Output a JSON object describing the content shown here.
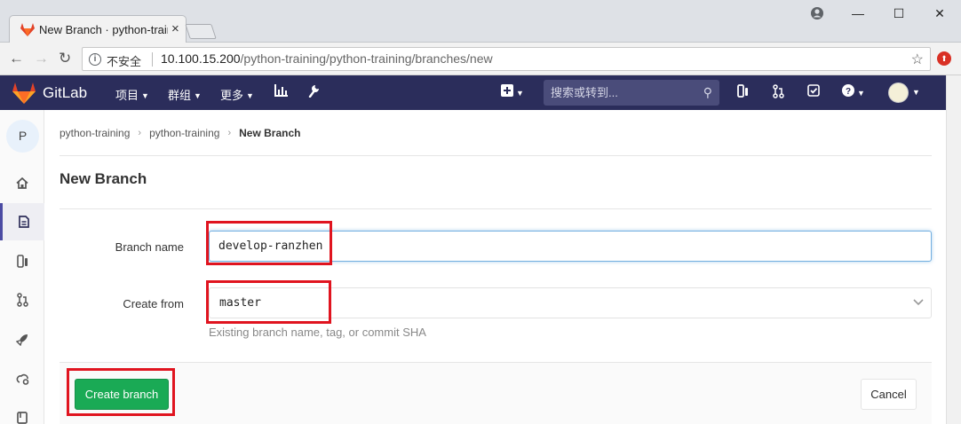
{
  "browser": {
    "tab_title": "New Branch · python-training · GitLab",
    "insecure_label": "不安全",
    "url_host": "10.100.15.200",
    "url_path": "/python-training/python-training/branches/new",
    "window_controls": [
      "profile-icon",
      "minimize-icon",
      "maximize-icon",
      "close-icon"
    ]
  },
  "navbar": {
    "brand": "GitLab",
    "menus": [
      {
        "label": "项目"
      },
      {
        "label": "群组"
      },
      {
        "label": "更多"
      }
    ],
    "search_placeholder": "搜索或转到...",
    "icons": [
      "activity-chart-icon",
      "admin-wrench-icon",
      "new-plus-icon",
      "issues-icon",
      "merge-requests-icon",
      "todos-icon",
      "help-icon",
      "user-avatar"
    ]
  },
  "sidebar": {
    "project_initial": "P",
    "items": [
      "home-icon",
      "repository-icon",
      "issues-icon",
      "merge-requests-icon",
      "ci-cd-icon",
      "operations-icon",
      "wiki-icon"
    ],
    "active_index": 1
  },
  "breadcrumb": {
    "items": [
      "python-training",
      "python-training"
    ],
    "current": "New Branch"
  },
  "page": {
    "title": "New Branch"
  },
  "form": {
    "branch_name_label": "Branch name",
    "branch_name_value": "develop-ranzhen",
    "create_from_label": "Create from",
    "create_from_value": "master",
    "help_text": "Existing branch name, tag, or commit SHA",
    "create_button": "Create branch",
    "cancel_button": "Cancel"
  },
  "colors": {
    "navbar": "#2b2d5b",
    "primary_button": "#1aaa55",
    "annotation": "#e0141f"
  }
}
